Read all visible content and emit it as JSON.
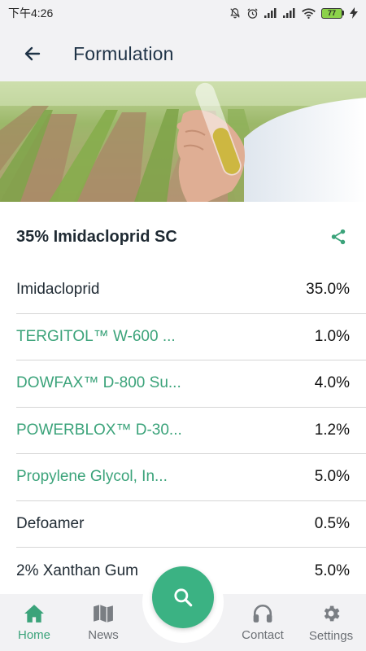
{
  "status_bar": {
    "time": "下午4:26",
    "battery_level": "77",
    "icons": [
      "mute-bell-icon",
      "alarm-icon",
      "signal-icon",
      "signal-icon",
      "wifi-icon",
      "battery-icon",
      "charging-icon"
    ]
  },
  "app_bar": {
    "title": "Formulation",
    "back_icon": "arrow-left-icon"
  },
  "hero": {
    "image": "hand-holding-test-tube-over-crop-field"
  },
  "product": {
    "title": "35% Imidacloprid SC",
    "share_icon": "share-icon"
  },
  "ingredients": [
    {
      "name": "Imidacloprid",
      "percent": "35.0%",
      "linked": false
    },
    {
      "name": "TERGITOL™ W-600 ...",
      "percent": "1.0%",
      "linked": true
    },
    {
      "name": "DOWFAX™ D-800 Su...",
      "percent": "4.0%",
      "linked": true
    },
    {
      "name": "POWERBLOX™ D-30...",
      "percent": "1.2%",
      "linked": true
    },
    {
      "name": "Propylene Glycol, In...",
      "percent": "5.0%",
      "linked": true
    },
    {
      "name": "Defoamer",
      "percent": "0.5%",
      "linked": false
    },
    {
      "name": "2% Xanthan Gum",
      "percent": "5.0%",
      "linked": false
    }
  ],
  "bottom_nav": {
    "items": [
      {
        "label": "Home",
        "icon": "home-icon",
        "active": true
      },
      {
        "label": "News",
        "icon": "map-icon",
        "active": false
      },
      {
        "label": "Contact",
        "icon": "headphones-icon",
        "active": false
      },
      {
        "label": "Settings",
        "icon": "gear-icon",
        "active": false
      }
    ],
    "fab_icon": "search-icon"
  },
  "colors": {
    "accent": "#3bb283",
    "link": "#3ba37a",
    "bar_background": "#f2f2f4",
    "text_dark": "#1f2a33",
    "divider": "#d6d6d6"
  }
}
